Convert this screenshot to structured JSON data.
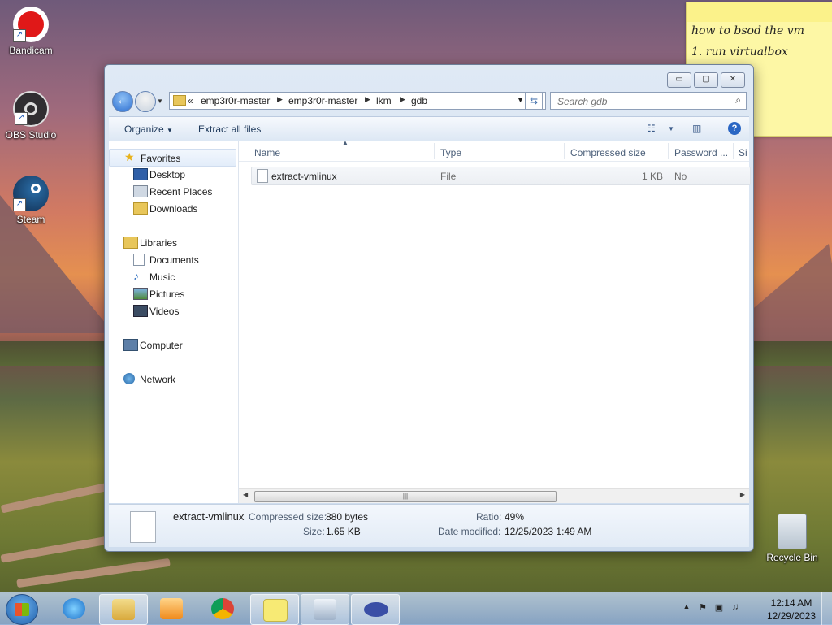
{
  "desktop": {
    "icons": [
      {
        "label": "Bandicam",
        "icon": "bandicam-icon"
      },
      {
        "label": "OBS Studio",
        "icon": "obs-icon"
      },
      {
        "label": "Steam",
        "icon": "steam-icon"
      },
      {
        "label": "Recycle Bin",
        "icon": "recycle-bin-icon"
      }
    ],
    "sticky_note": {
      "text": "how to bsod the vm\n1. run virtualbox"
    }
  },
  "window": {
    "controls": {
      "minimize": "▭",
      "maximize": "▢",
      "close": "✕"
    },
    "address": {
      "overflow": "«",
      "crumbs": [
        "emp3r0r-master",
        "emp3r0r-master",
        "lkm",
        "gdb"
      ]
    },
    "search": {
      "placeholder": "Search gdb"
    },
    "toolbar": {
      "organize": "Organize",
      "extract_all": "Extract all files"
    },
    "nav": {
      "favorites": "Favorites",
      "desktop": "Desktop",
      "recent_places": "Recent Places",
      "downloads": "Downloads",
      "libraries": "Libraries",
      "documents": "Documents",
      "music": "Music",
      "pictures": "Pictures",
      "videos": "Videos",
      "computer": "Computer",
      "network": "Network"
    },
    "columns": {
      "name": "Name",
      "type": "Type",
      "compressed_size": "Compressed size",
      "password": "Password ...",
      "size_trunc": "Si"
    },
    "files": [
      {
        "name": "extract-vmlinux",
        "type": "File",
        "compressed_size": "1 KB",
        "password": "No"
      }
    ],
    "details": {
      "name": "extract-vmlinux",
      "compressed_size_label": "Compressed size:",
      "compressed_size": "880 bytes",
      "size_label": "Size:",
      "size": "1.65 KB",
      "ratio_label": "Ratio:",
      "ratio": "49%",
      "date_label": "Date modified:",
      "date": "12/25/2023 1:49 AM"
    }
  },
  "taskbar": {
    "clock_time": "12:14 AM",
    "clock_date": "12/29/2023"
  }
}
